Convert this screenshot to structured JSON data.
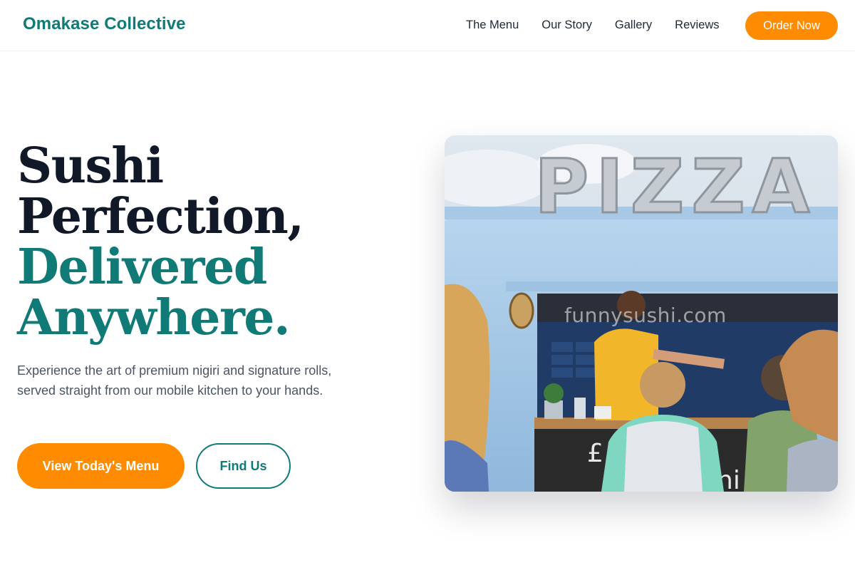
{
  "header": {
    "brand": "Omakase Collective",
    "nav": [
      "The Menu",
      "Our Story",
      "Gallery",
      "Reviews"
    ],
    "order_label": "Order Now"
  },
  "hero": {
    "title_line1": "Sushi",
    "title_line2": "Perfection,",
    "title_line3": "Delivered",
    "title_line4": "Anywhere.",
    "subtitle": "Experience the art of premium nigiri and signature rolls, served straight from our mobile kitchen to your hands.",
    "primary_label": "View Today's Menu",
    "secondary_label": "Find Us",
    "image": {
      "watermark": "funnysushi.com",
      "sign_text": "PIZZA",
      "board_text_top": "£ erit",
      "board_text_bottom": "oni"
    }
  },
  "colors": {
    "brand": "#0f7a76",
    "accent": "#ff8c00",
    "heading": "#111827",
    "body": "#4b5563"
  }
}
